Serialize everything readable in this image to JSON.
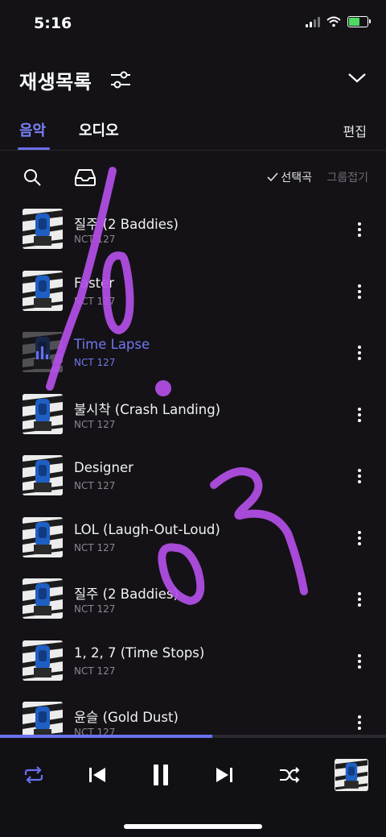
{
  "status_bar": {
    "time": "5:16"
  },
  "header": {
    "title": "재생목록"
  },
  "tabs": [
    {
      "label": "음악",
      "active": true
    },
    {
      "label": "오디오",
      "active": false
    }
  ],
  "edit_label": "편집",
  "toolbar": {
    "select_label": "선택곡",
    "group_label": "그룹접기"
  },
  "playlist": [
    {
      "title": "질주 (2 Baddies)",
      "artist": "NCT 127",
      "playing": false
    },
    {
      "title": "Faster",
      "artist": "NCT 127",
      "playing": false
    },
    {
      "title": "Time Lapse",
      "artist": "NCT 127",
      "playing": true
    },
    {
      "title": "불시착 (Crash Landing)",
      "artist": "NCT 127",
      "playing": false
    },
    {
      "title": "Designer",
      "artist": "NCT 127",
      "playing": false
    },
    {
      "title": "LOL (Laugh-Out-Loud)",
      "artist": "NCT 127",
      "playing": false
    },
    {
      "title": "질주 (2 Baddies)",
      "artist": "NCT 127",
      "playing": false
    },
    {
      "title": "1, 2, 7 (Time Stops)",
      "artist": "NCT 127",
      "playing": false
    },
    {
      "title": "윤슬 (Gold Dust)",
      "artist": "NCT 127",
      "playing": false
    }
  ],
  "player": {
    "progress_fraction": 0.55
  },
  "colors": {
    "accent": "#6a71ee",
    "background": "#141216",
    "scribble": "#b44fe8"
  },
  "icons": [
    "filter-icon",
    "chevron-down-icon",
    "search-icon",
    "tray-icon",
    "check-icon",
    "more-vertical-icon",
    "repeat-icon",
    "previous-icon",
    "pause-icon",
    "next-icon",
    "shuffle-icon"
  ]
}
